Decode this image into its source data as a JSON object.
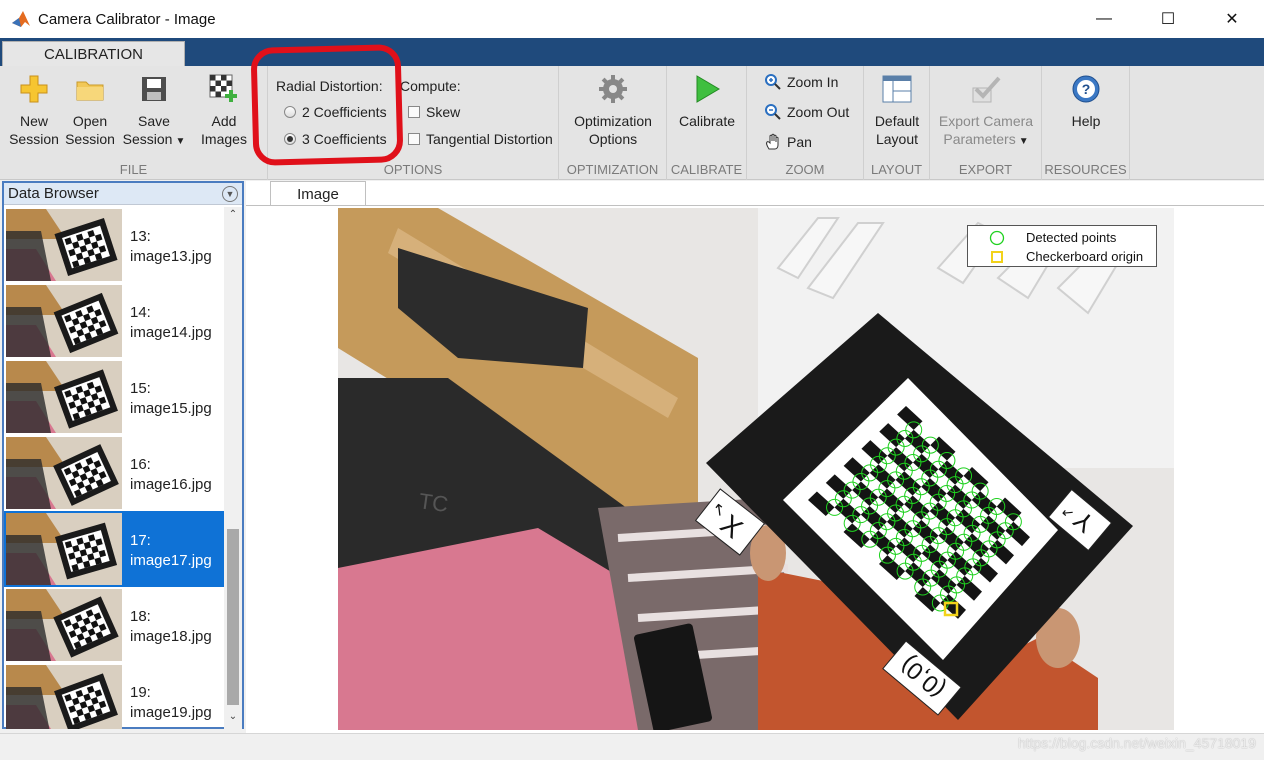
{
  "window": {
    "title": "Camera Calibrator - Image",
    "icon": "matlab-icon",
    "controls": [
      "minimize",
      "maximize",
      "close"
    ]
  },
  "ribbon": {
    "tab": "CALIBRATION",
    "file": {
      "label": "FILE",
      "new_session": [
        "New",
        "Session"
      ],
      "open_session": [
        "Open",
        "Session"
      ],
      "save_session": [
        "Save",
        "Session"
      ],
      "add_images": [
        "Add",
        "Images"
      ]
    },
    "options": {
      "label": "OPTIONS",
      "radial_heading": "Radial Distortion:",
      "radial_options": [
        "2 Coefficients",
        "3 Coefficients"
      ],
      "radial_selected": "3 Coefficients",
      "compute_heading": "Compute:",
      "skew": "Skew",
      "tangential": "Tangential Distortion"
    },
    "optimization": {
      "label": "OPTIMIZATION",
      "button": [
        "Optimization",
        "Options"
      ]
    },
    "calibrate": {
      "label": "CALIBRATE",
      "button": "Calibrate"
    },
    "zoom": {
      "label": "ZOOM",
      "zoom_in": "Zoom In",
      "zoom_out": "Zoom Out",
      "pan": "Pan"
    },
    "layout": {
      "label": "LAYOUT",
      "button": [
        "Default",
        "Layout"
      ]
    },
    "export": {
      "label": "EXPORT",
      "button": [
        "Export Camera",
        "Parameters"
      ]
    },
    "resources": {
      "label": "RESOURCES",
      "button": "Help"
    }
  },
  "data_browser": {
    "title": "Data Browser",
    "selected": "17",
    "items": [
      {
        "num": "13:",
        "file": "image13.jpg"
      },
      {
        "num": "14:",
        "file": "image14.jpg"
      },
      {
        "num": "15:",
        "file": "image15.jpg"
      },
      {
        "num": "16:",
        "file": "image16.jpg"
      },
      {
        "num": "17:",
        "file": "image17.jpg"
      },
      {
        "num": "18:",
        "file": "image18.jpg"
      },
      {
        "num": "19:",
        "file": "image19.jpg"
      }
    ]
  },
  "image_pane": {
    "tab": "Image",
    "legend": {
      "detected": "Detected points",
      "origin": "Checkerboard origin"
    },
    "labels": {
      "x_axis": "X",
      "y_axis": "Y",
      "origin": "(0,0)"
    },
    "colors": {
      "detected": "#1fd11f",
      "origin": "#f2d21a"
    }
  },
  "watermark": "https://blog.csdn.net/weixin_45718019",
  "colors": {
    "ribbon_blue": "#1f4a7c",
    "selection": "#0f72d6",
    "annotation_red": "#e0101a"
  }
}
